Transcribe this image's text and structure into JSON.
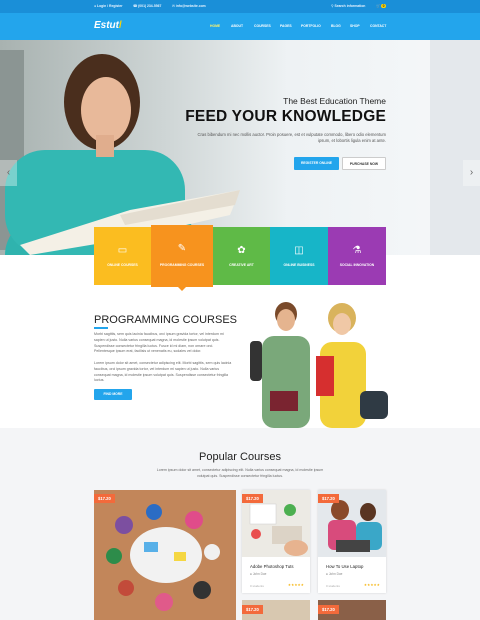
{
  "topbar": {
    "login": "Login / Register",
    "phone": "(001) 234-5567",
    "email": "info@website.com",
    "search_placeholder": "Search information",
    "cart_count": "0"
  },
  "nav": {
    "logo": "Estut",
    "items": [
      "HOME",
      "ABOUT",
      "COURSES",
      "PAGES",
      "PORTFOLIO",
      "BLOG",
      "SHOP",
      "CONTACT"
    ]
  },
  "hero": {
    "subtitle": "The Best Education Theme",
    "title": "FEED YOUR KNOWLEDGE",
    "text": "Cras bibendum mi nec mollis auctor. Proin posuere, est et vulputate commodo, libero odio elementum ipsum, et lobortis ligula enim at ante.",
    "btn_primary": "REGISTER ONLINE",
    "btn_secondary": "PURCHASE NOW"
  },
  "categories": [
    {
      "label": "ONLINE COURSES",
      "icon": "laptop-icon",
      "color": "#fbbd20"
    },
    {
      "label": "PROGRAMMING COURSES",
      "icon": "document-icon",
      "color": "#f7931e"
    },
    {
      "label": "CREATIVE ART",
      "icon": "palette-icon",
      "color": "#5fba47"
    },
    {
      "label": "ONLINE BUSINESS",
      "icon": "cart-icon",
      "color": "#17b5c8"
    },
    {
      "label": "SOCIAL INNOVATION",
      "icon": "flask-icon",
      "color": "#9b3bb3"
    }
  ],
  "programming": {
    "title": "PROGRAMMING COURSES",
    "para1": "Morbi sagittis, sem quis lacinia faucibus, orci ipsum gravida tortor, vel interdum mi sapien ut justo. Nulla varius consequat magna, id molestie ipsum volutpat quis. Suspendisse consectetur fringilla luctus. Fusce id mi diam, non ornare orci. Pellentesque ipsum erat, facilisis ut venenatis eu, sodales vel dolor.",
    "para2": "Lorem ipsum dolor sit amet, consectetur adipiscing elit. Morbi sagittis, sem quis lacinia faucibus, orci ipsum gravida tortor, vel interdum mi sapien ut justo. Nulla varius consequat magna, id molestie ipsum volutpat quis. Suspendisse consectetur fringilla luctus.",
    "button": "FIND MORE"
  },
  "popular": {
    "title": "Popular Courses",
    "text": "Lorem ipsum dolor sit amet, consectetur adipiscing elit. Nulla varius consequat magna, id molestie ipsum volutpat quis. Suspendisse consectetur fringilla luctus.",
    "featured_price": "$17.20",
    "cards": [
      {
        "price": "$17.20",
        "title": "Adobe Photoshop Tuts",
        "author": "John Doe",
        "students": "0 students",
        "stars": "★★★★★"
      },
      {
        "price": "$17.20",
        "title": "How To Use Laptop",
        "author": "John Doe",
        "students": "0 students",
        "stars": "★★★★★"
      }
    ],
    "bottom_prices": [
      "$17.20",
      "$17.20"
    ]
  }
}
